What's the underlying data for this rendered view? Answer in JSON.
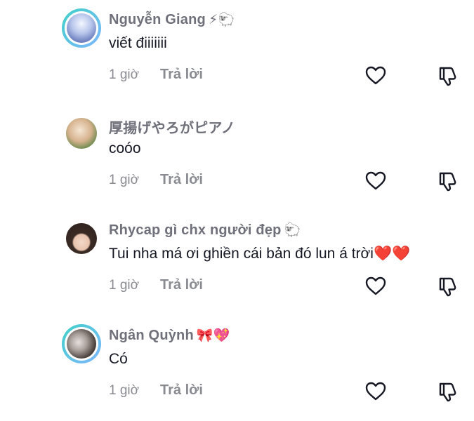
{
  "comments": [
    {
      "username": "Nguyễn Giang",
      "badge": "⚡🐑",
      "text": "viết điiiiiii",
      "time": "1 giờ",
      "reply_label": "Trả lời",
      "avatar_style": "ring",
      "avatar_colors": [
        "#dfe7f6",
        "#3a4fa0"
      ]
    },
    {
      "username": "厚揚げやろがピアノ",
      "badge": "",
      "text": "coóo",
      "time": "1 giờ",
      "reply_label": "Trả lời",
      "avatar_style": "plain",
      "avatar_colors": [
        "#e9d8c4",
        "#8a6a4d"
      ]
    },
    {
      "username": "Rhycap gì chx người đẹp",
      "badge": "🐑",
      "text": "Tui nha má ơi ghiền cái bản đó lun á trời",
      "text_hearts": "❤️❤️",
      "time": "1 giờ",
      "reply_label": "Trả lời",
      "avatar_style": "plain",
      "avatar_colors": [
        "#f1e4dc",
        "#3b2b25"
      ]
    },
    {
      "username": "Ngân Quỳnh",
      "badge": "🎀💖",
      "text": "Có",
      "time": "1 giờ",
      "reply_label": "Trả lời",
      "avatar_style": "ring",
      "avatar_colors": [
        "#c9c3c0",
        "#2a2422"
      ]
    }
  ],
  "icons": {
    "like": "heart-outline-icon",
    "dislike": "thumbs-down-outline-icon"
  },
  "colors": {
    "username": "#6f7079",
    "text": "#161823",
    "meta": "#8a8b91",
    "ring": "#3fd1c8"
  }
}
